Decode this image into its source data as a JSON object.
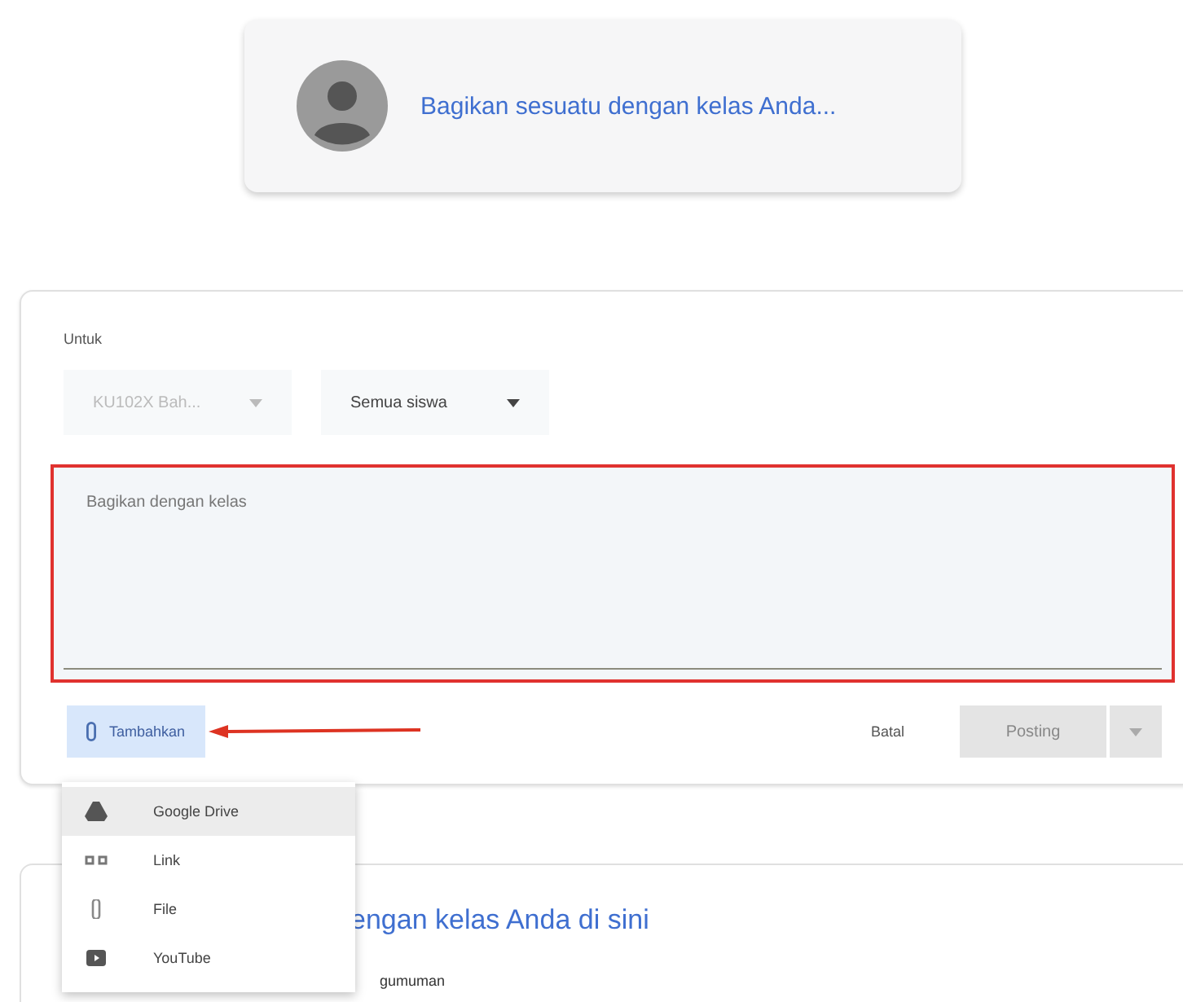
{
  "share_prompt": {
    "text": "Bagikan sesuatu dengan kelas Anda..."
  },
  "composer": {
    "for_label": "Untuk",
    "dropdowns": [
      {
        "value": "KU102X Bah...",
        "disabled": true
      },
      {
        "value": "Semua siswa",
        "disabled": false
      }
    ],
    "textarea": {
      "placeholder": "Bagikan dengan kelas"
    },
    "add_button": {
      "label": "Tambahkan"
    },
    "cancel_button": {
      "label": "Batal"
    },
    "post_button": {
      "label": "Posting",
      "disabled": true
    }
  },
  "add_menu": {
    "items": [
      {
        "kind": "drive",
        "label": "Google Drive",
        "selected": true
      },
      {
        "kind": "link",
        "label": "Link",
        "selected": false
      },
      {
        "kind": "file",
        "label": "File",
        "selected": false
      },
      {
        "kind": "youtube",
        "label": "YouTube",
        "selected": false
      }
    ]
  },
  "stream_card": {
    "title": "engan kelas Anda di sini",
    "subtitle": "gumuman"
  }
}
